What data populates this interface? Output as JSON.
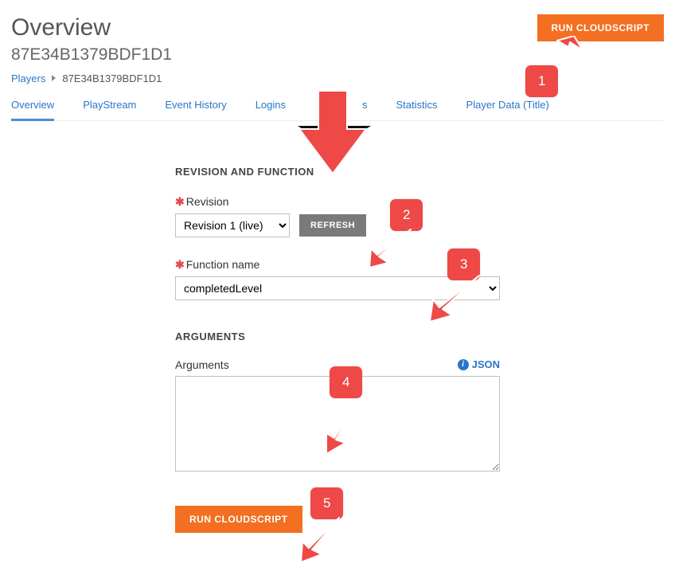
{
  "header": {
    "title": "Overview",
    "subtitle": "87E34B1379BDF1D1",
    "run_button": "RUN CLOUDSCRIPT"
  },
  "breadcrumb": {
    "root": "Players",
    "current": "87E34B1379BDF1D1"
  },
  "tabs": [
    "Overview",
    "PlayStream",
    "Event History",
    "Logins",
    "s",
    "Statistics",
    "Player Data (Title)"
  ],
  "active_tab_index": 0,
  "form": {
    "section_revision_head": "REVISION AND FUNCTION",
    "revision_label": "Revision",
    "revision_value": "Revision 1 (live)",
    "refresh_label": "REFRESH",
    "function_label": "Function name",
    "function_value": "completedLevel",
    "arguments_head": "ARGUMENTS",
    "arguments_label": "Arguments",
    "json_hint": "JSON",
    "arguments_value": "",
    "submit_label": "RUN CLOUDSCRIPT"
  },
  "callouts": {
    "c1": "1",
    "c2": "2",
    "c3": "3",
    "c4": "4",
    "c5": "5"
  }
}
